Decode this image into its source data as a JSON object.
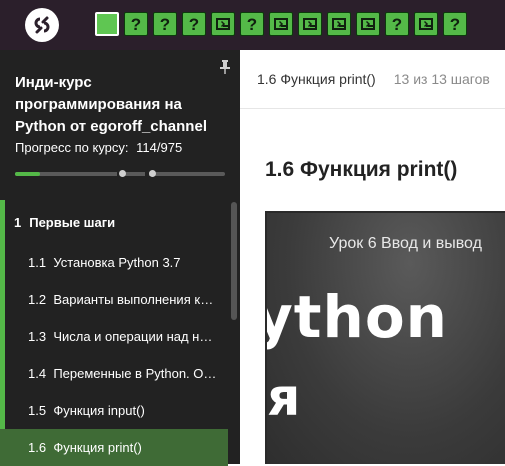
{
  "colors": {
    "topbar": "#2b1f2b",
    "sidebar": "#222222",
    "accent_green": "#54b948",
    "active_lesson": "#3f6b36"
  },
  "topbar": {
    "logo_icon": "stepik-logo-icon",
    "steps": [
      {
        "type": "text",
        "icon": "text-step-icon",
        "label": "",
        "active": true
      },
      {
        "type": "quiz",
        "icon": "question-icon",
        "label": "?"
      },
      {
        "type": "quiz",
        "icon": "question-icon",
        "label": "?"
      },
      {
        "type": "quiz",
        "icon": "question-icon",
        "label": "?"
      },
      {
        "type": "code",
        "icon": "code-icon",
        "label": ""
      },
      {
        "type": "quiz",
        "icon": "question-icon",
        "label": "?"
      },
      {
        "type": "code",
        "icon": "code-icon",
        "label": ""
      },
      {
        "type": "code",
        "icon": "code-icon",
        "label": ""
      },
      {
        "type": "code",
        "icon": "code-icon",
        "label": ""
      },
      {
        "type": "code",
        "icon": "code-icon",
        "label": ""
      },
      {
        "type": "quiz",
        "icon": "question-icon",
        "label": "?"
      },
      {
        "type": "code",
        "icon": "code-icon",
        "label": ""
      },
      {
        "type": "quiz",
        "icon": "question-icon",
        "label": "?"
      }
    ]
  },
  "sidebar": {
    "course_title": "Инди-курс программирования на Python от egoroff_channel",
    "progress_label": "Прогресс по курсу:",
    "progress_value": "114/975",
    "progress_fraction": 0.117,
    "module": {
      "number": "1",
      "title": "Первые шаги"
    },
    "lessons": [
      {
        "number": "1.1",
        "title": "Установка Python 3.7"
      },
      {
        "number": "1.2",
        "title": "Варианты выполнения кода"
      },
      {
        "number": "1.3",
        "title": "Числа и операции над ними"
      },
      {
        "number": "1.4",
        "title": "Переменные в Python. Оператор присваивания"
      },
      {
        "number": "1.5",
        "title": "Функция input()"
      },
      {
        "number": "1.6",
        "title": "Функция print()",
        "active": true
      }
    ]
  },
  "header": {
    "lesson_title": "1.6 Функция print()",
    "step_count": "13 из 13 шагов"
  },
  "content": {
    "heading": "1.6 Функция print()",
    "video": {
      "caption": "Урок 6 Ввод и вывод",
      "big_text_1": "ython",
      "big_text_2": "я"
    }
  }
}
